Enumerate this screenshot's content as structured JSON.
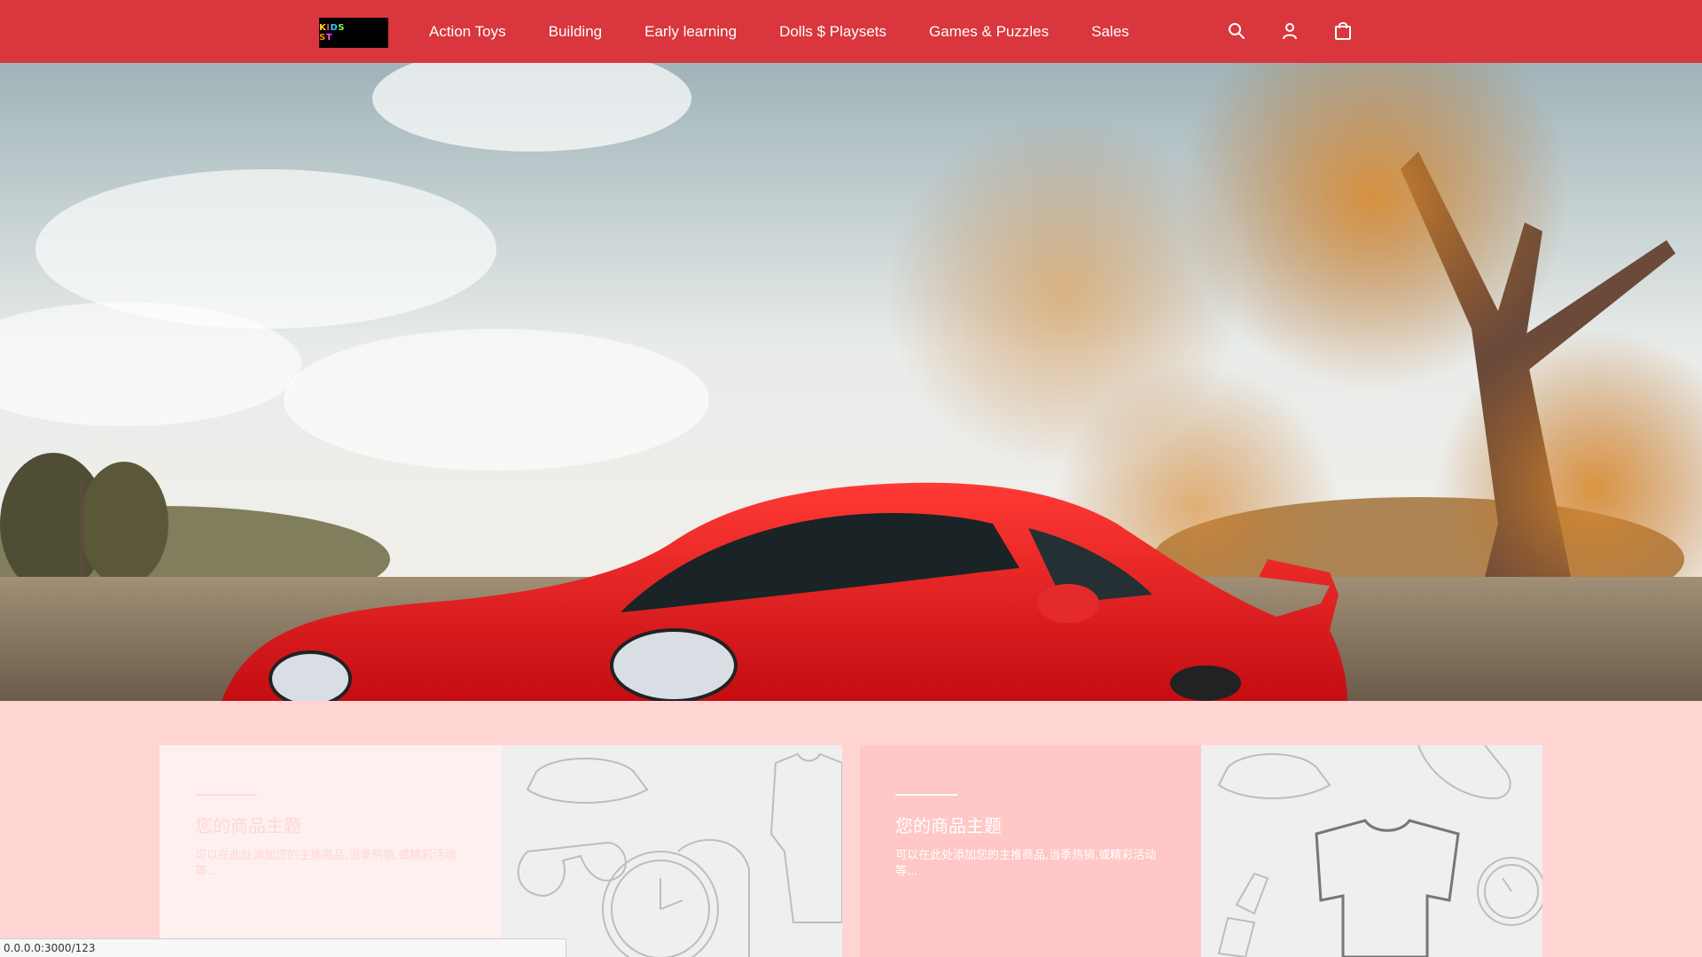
{
  "header": {
    "logo_text": "KIDS STATION",
    "nav": [
      {
        "label": "Action Toys"
      },
      {
        "label": "Building"
      },
      {
        "label": "Early learning"
      },
      {
        "label": "Dolls $ Playsets"
      },
      {
        "label": "Games & Puzzles"
      },
      {
        "label": "Sales"
      }
    ],
    "icons": [
      "search-icon",
      "account-icon",
      "shopping-bag-icon"
    ]
  },
  "hero": {
    "subject": "red sports car under autumn trees"
  },
  "cards": [
    {
      "title": "您的商品主题",
      "description": "可以在此处添加您的主推商品,当季热销,或精彩活动等..."
    },
    {
      "title": "您的商品主题",
      "description": "可以在此处添加您的主推商品,当季热销,或精彩活动等..."
    }
  ],
  "status_bar": {
    "url": "0.0.0.0:3000/123"
  },
  "colors": {
    "header_bg": "#d9363e",
    "page_bg": "#ffd5d3",
    "card_accent": "#ffc7c6"
  }
}
